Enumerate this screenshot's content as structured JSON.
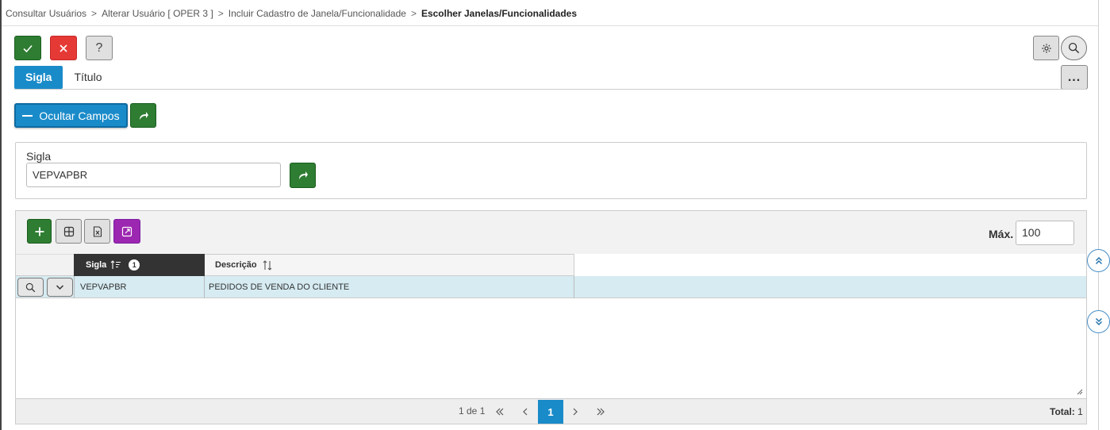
{
  "breadcrumb": {
    "items": [
      "Consultar Usuários",
      "Alterar Usuário [ OPER 3 ]",
      "Incluir Cadastro de Janela/Funcionalidade"
    ],
    "separator": ">",
    "current": "Escolher Janelas/Funcionalidades"
  },
  "toolbar": {
    "confirm_icon": "check-icon",
    "cancel_icon": "close-icon",
    "help_label": "?",
    "settings_icon": "gear-icon",
    "search_icon": "search-icon",
    "more_label": "..."
  },
  "tabs": [
    {
      "label": "Sigla",
      "active": true
    },
    {
      "label": "Título",
      "active": false
    }
  ],
  "filters": {
    "toggle_label": "Ocultar Campos",
    "sigla_label": "Sigla",
    "sigla_value": "VEPVAPBR"
  },
  "grid": {
    "max_label": "Máx.",
    "max_value": "100",
    "columns": [
      {
        "label": "Sigla",
        "sort_badge": "1"
      },
      {
        "label": "Descrição"
      }
    ],
    "rows": [
      {
        "sigla": "VEPVAPBR",
        "descricao": "PEDIDOS DE VENDA DO CLIENTE"
      }
    ],
    "pagination": {
      "info": "1 de 1",
      "current_page": "1",
      "total_label": "Total:",
      "total_value": "1"
    }
  },
  "colors": {
    "primary": "#1a8bc9",
    "success": "#2e7d32",
    "danger": "#e53935",
    "purple": "#9c27b0",
    "header_dark": "#333333",
    "row_highlight": "#d6ebf2"
  }
}
